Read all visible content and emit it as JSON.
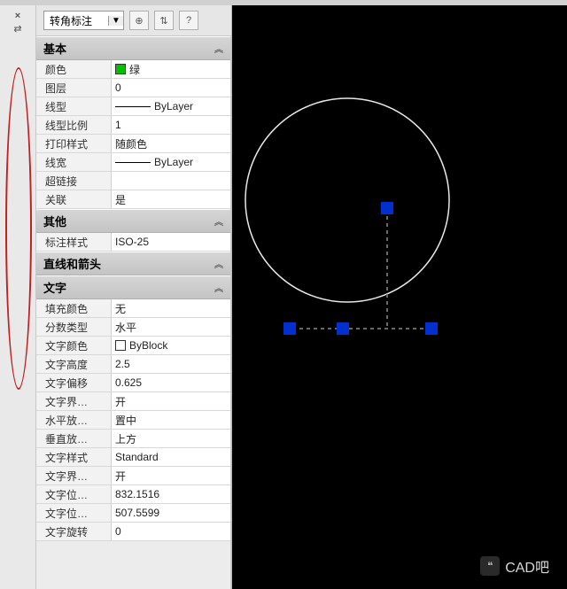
{
  "toolbar": {
    "selection_label": "转角标注",
    "btn1": "⊕",
    "btn2": "⇅",
    "btn3": "?"
  },
  "left": {
    "close": "×",
    "pin": "⇄"
  },
  "sections": {
    "basic": {
      "title": "基本",
      "color_label": "颜色",
      "color_value": "绿",
      "layer_label": "图层",
      "layer_value": "0",
      "linetype_label": "线型",
      "linetype_value": "ByLayer",
      "ltscale_label": "线型比例",
      "ltscale_value": "1",
      "plotstyle_label": "打印样式",
      "plotstyle_value": "随颜色",
      "lineweight_label": "线宽",
      "lineweight_value": "ByLayer",
      "hyperlink_label": "超链接",
      "hyperlink_value": "",
      "assoc_label": "关联",
      "assoc_value": "是"
    },
    "misc": {
      "title": "其他",
      "dimstyle_label": "标注样式",
      "dimstyle_value": "ISO-25"
    },
    "lines": {
      "title": "直线和箭头"
    },
    "text": {
      "title": "文字",
      "fill_label": "填充颜色",
      "fill_value": "无",
      "fraction_label": "分数类型",
      "fraction_value": "水平",
      "textcolor_label": "文字颜色",
      "textcolor_value": "ByBlock",
      "textheight_label": "文字高度",
      "textheight_value": "2.5",
      "textoffset_label": "文字偏移",
      "textoffset_value": "0.625",
      "textframe_label": "文字界…",
      "textframe_value": "开",
      "halign_label": "水平放…",
      "halign_value": "置中",
      "valign_label": "垂直放…",
      "valign_value": "上方",
      "textstyle_label": "文字样式",
      "textstyle_value": "Standard",
      "textframe2_label": "文字界…",
      "textframe2_value": "开",
      "textpos1_label": "文字位…",
      "textpos1_value": "832.1516",
      "textpos2_label": "文字位…",
      "textpos2_value": "507.5599",
      "textrot_label": "文字旋转",
      "textrot_value": "0"
    }
  },
  "watermark": {
    "icon": "❝",
    "text": "CAD吧"
  }
}
